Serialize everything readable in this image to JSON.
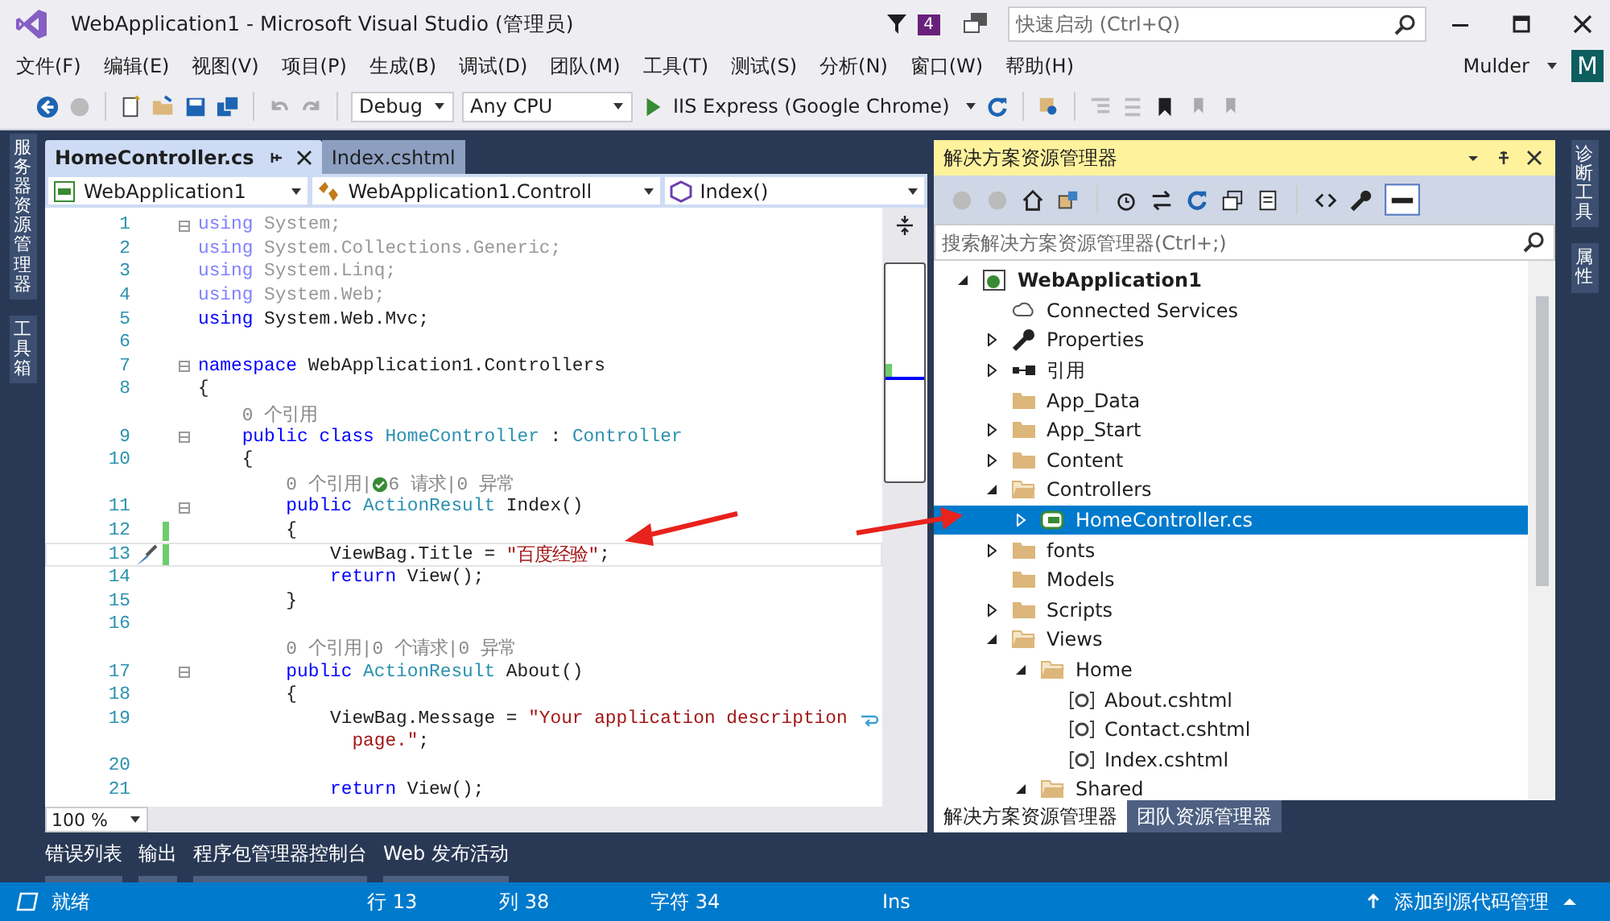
{
  "window": {
    "title": "WebApplication1 - Microsoft Visual Studio (管理员)",
    "notifications": "4",
    "quick_launch": {
      "placeholder": "快速启动 (Ctrl+Q)"
    }
  },
  "menu": [
    "文件(F)",
    "编辑(E)",
    "视图(V)",
    "项目(P)",
    "生成(B)",
    "调试(D)",
    "团队(M)",
    "工具(T)",
    "测试(S)",
    "分析(N)",
    "窗口(W)",
    "帮助(H)"
  ],
  "user": {
    "name": "Mulder",
    "initial": "M"
  },
  "toolbar": {
    "configuration": "Debug",
    "platform": "Any CPU",
    "run": "IIS Express (Google Chrome)"
  },
  "left_tabs": [
    "服务器资源管理器",
    "工具箱"
  ],
  "right_tabs": [
    "诊断工具",
    "属性"
  ],
  "editor": {
    "tabs": [
      {
        "label": "HomeController.cs",
        "selected": true
      },
      {
        "label": "Index.cshtml",
        "selected": false
      }
    ],
    "nav": [
      "WebApplication1",
      "WebApplication1.Controll",
      "Index()"
    ],
    "lines": [
      {
        "number": "1",
        "fold": true,
        "tokens": [
          {
            "kind": "fkw",
            "t": "using"
          },
          {
            "kind": "faded",
            "t": " System;"
          }
        ]
      },
      {
        "number": "2",
        "tokens": [
          {
            "kind": "fkw",
            "t": "using"
          },
          {
            "kind": "faded",
            "t": " System.Collections.Generic;"
          }
        ]
      },
      {
        "number": "3",
        "tokens": [
          {
            "kind": "fkw",
            "t": "using"
          },
          {
            "kind": "faded",
            "t": " System.Linq;"
          }
        ]
      },
      {
        "number": "4",
        "tokens": [
          {
            "kind": "fkw",
            "t": "using"
          },
          {
            "kind": "faded",
            "t": " System.Web;"
          }
        ]
      },
      {
        "number": "5",
        "tokens": [
          {
            "kind": "kw",
            "t": "using"
          },
          {
            "kind": "text",
            "t": " System.Web.Mvc;"
          }
        ]
      },
      {
        "number": "6"
      },
      {
        "number": "7",
        "fold": true,
        "tokens": [
          {
            "kind": "kw",
            "t": "namespace"
          },
          {
            "kind": "text",
            "t": " WebApplication1.Controllers"
          }
        ]
      },
      {
        "number": "8",
        "tokens": [
          {
            "kind": "text",
            "t": "{"
          }
        ]
      },
      {
        "tokens": [
          {
            "kind": "lens",
            "t": "    0 个引用"
          }
        ]
      },
      {
        "number": "9",
        "fold": true,
        "tokens": [
          {
            "kind": "kw",
            "t": "    public class"
          },
          {
            "kind": "type",
            "t": " HomeController"
          },
          {
            "kind": "text",
            "t": " : "
          },
          {
            "kind": "type",
            "t": "Controller"
          }
        ]
      },
      {
        "number": "10",
        "tokens": [
          {
            "kind": "text",
            "t": "    {"
          }
        ]
      },
      {
        "tokens": [
          {
            "kind": "lens",
            "t": "        0 个引用|"
          },
          {
            "kind": "check"
          },
          {
            "kind": "lens",
            "t": "6 请求|0 异常"
          }
        ]
      },
      {
        "number": "11",
        "fold": true,
        "tokens": [
          {
            "kind": "kw",
            "t": "        public"
          },
          {
            "kind": "type",
            "t": " ActionResult"
          },
          {
            "kind": "text",
            "t": " Index()"
          }
        ]
      },
      {
        "number": "12",
        "changed": true,
        "tokens": [
          {
            "kind": "text",
            "t": "        {"
          }
        ]
      },
      {
        "number": "13",
        "changed": true,
        "current": true,
        "quick_action": true,
        "tokens": [
          {
            "kind": "text",
            "t": "            ViewBag.Title = "
          },
          {
            "kind": "str",
            "t": "\"百度经验\""
          },
          {
            "kind": "text",
            "t": ";"
          }
        ]
      },
      {
        "number": "14",
        "tokens": [
          {
            "kind": "kw",
            "t": "            return"
          },
          {
            "kind": "text",
            "t": " View();"
          }
        ]
      },
      {
        "number": "15",
        "tokens": [
          {
            "kind": "text",
            "t": "        }"
          }
        ]
      },
      {
        "number": "16"
      },
      {
        "tokens": [
          {
            "kind": "lens",
            "t": "        0 个引用|0 个请求|0 异常"
          }
        ]
      },
      {
        "number": "17",
        "fold": true,
        "tokens": [
          {
            "kind": "kw",
            "t": "        public"
          },
          {
            "kind": "type",
            "t": " ActionResult"
          },
          {
            "kind": "text",
            "t": " About()"
          }
        ]
      },
      {
        "number": "18",
        "tokens": [
          {
            "kind": "text",
            "t": "        {"
          }
        ]
      },
      {
        "number": "19",
        "wrapped": true,
        "tokens": [
          {
            "kind": "text",
            "t": "            ViewBag.Message = "
          },
          {
            "kind": "str",
            "t": "\"Your application description"
          }
        ]
      },
      {
        "tokens": [
          {
            "kind": "str",
            "t": "              page.\""
          },
          {
            "kind": "text",
            "t": ";"
          }
        ]
      },
      {
        "number": "20"
      },
      {
        "number": "21",
        "tokens": [
          {
            "kind": "kw",
            "t": "            return"
          },
          {
            "kind": "text",
            "t": " View();"
          }
        ]
      }
    ],
    "zoom": "100 %"
  },
  "solution_explorer": {
    "title": "解决方案资源管理器",
    "search": {
      "placeholder": "搜索解决方案资源管理器(Ctrl+;)"
    },
    "tree": [
      {
        "label": "WebApplication1",
        "kind": "project",
        "expanded": true,
        "selected": false,
        "children": [
          {
            "label": "Connected Services",
            "kind": "service",
            "selected": false
          },
          {
            "label": "Properties",
            "kind": "properties",
            "expanded": false,
            "selected": false
          },
          {
            "label": "引用",
            "kind": "references",
            "expanded": false,
            "selected": false
          },
          {
            "label": "App_Data",
            "kind": "folder",
            "selected": false
          },
          {
            "label": "App_Start",
            "kind": "folder",
            "expanded": false,
            "selected": false
          },
          {
            "label": "Content",
            "kind": "folder",
            "expanded": false,
            "selected": false
          },
          {
            "label": "Controllers",
            "kind": "folder",
            "expanded": true,
            "selected": false,
            "children": [
              {
                "label": "HomeController.cs",
                "kind": "cs",
                "expanded": false,
                "selected": true
              }
            ]
          },
          {
            "label": "fonts",
            "kind": "folder",
            "expanded": false,
            "selected": false
          },
          {
            "label": "Models",
            "kind": "folder",
            "selected": false
          },
          {
            "label": "Scripts",
            "kind": "folder",
            "expanded": false,
            "selected": false
          },
          {
            "label": "Views",
            "kind": "folder",
            "expanded": true,
            "selected": false,
            "children": [
              {
                "label": "Home",
                "kind": "folder",
                "expanded": true,
                "selected": false,
                "children": [
                  {
                    "label": "About.cshtml",
                    "kind": "cshtml",
                    "selected": false
                  },
                  {
                    "label": "Contact.cshtml",
                    "kind": "cshtml",
                    "selected": false
                  },
                  {
                    "label": "Index.cshtml",
                    "kind": "cshtml",
                    "selected": false
                  }
                ]
              },
              {
                "label": "Shared",
                "kind": "folder",
                "expanded": true,
                "selected": false
              }
            ]
          }
        ]
      }
    ],
    "tabs": [
      {
        "label": "解决方案资源管理器",
        "selected": true
      },
      {
        "label": "团队资源管理器",
        "selected": false
      }
    ]
  },
  "bottom_tabs": [
    "错误列表",
    "输出",
    "程序包管理器控制台",
    "Web 发布活动"
  ],
  "status_bar": {
    "ready": "就绪",
    "line": "行 13",
    "column": "列 38",
    "char": "字符 34",
    "mode": "Ins",
    "source_control": "添加到源代码管理"
  }
}
